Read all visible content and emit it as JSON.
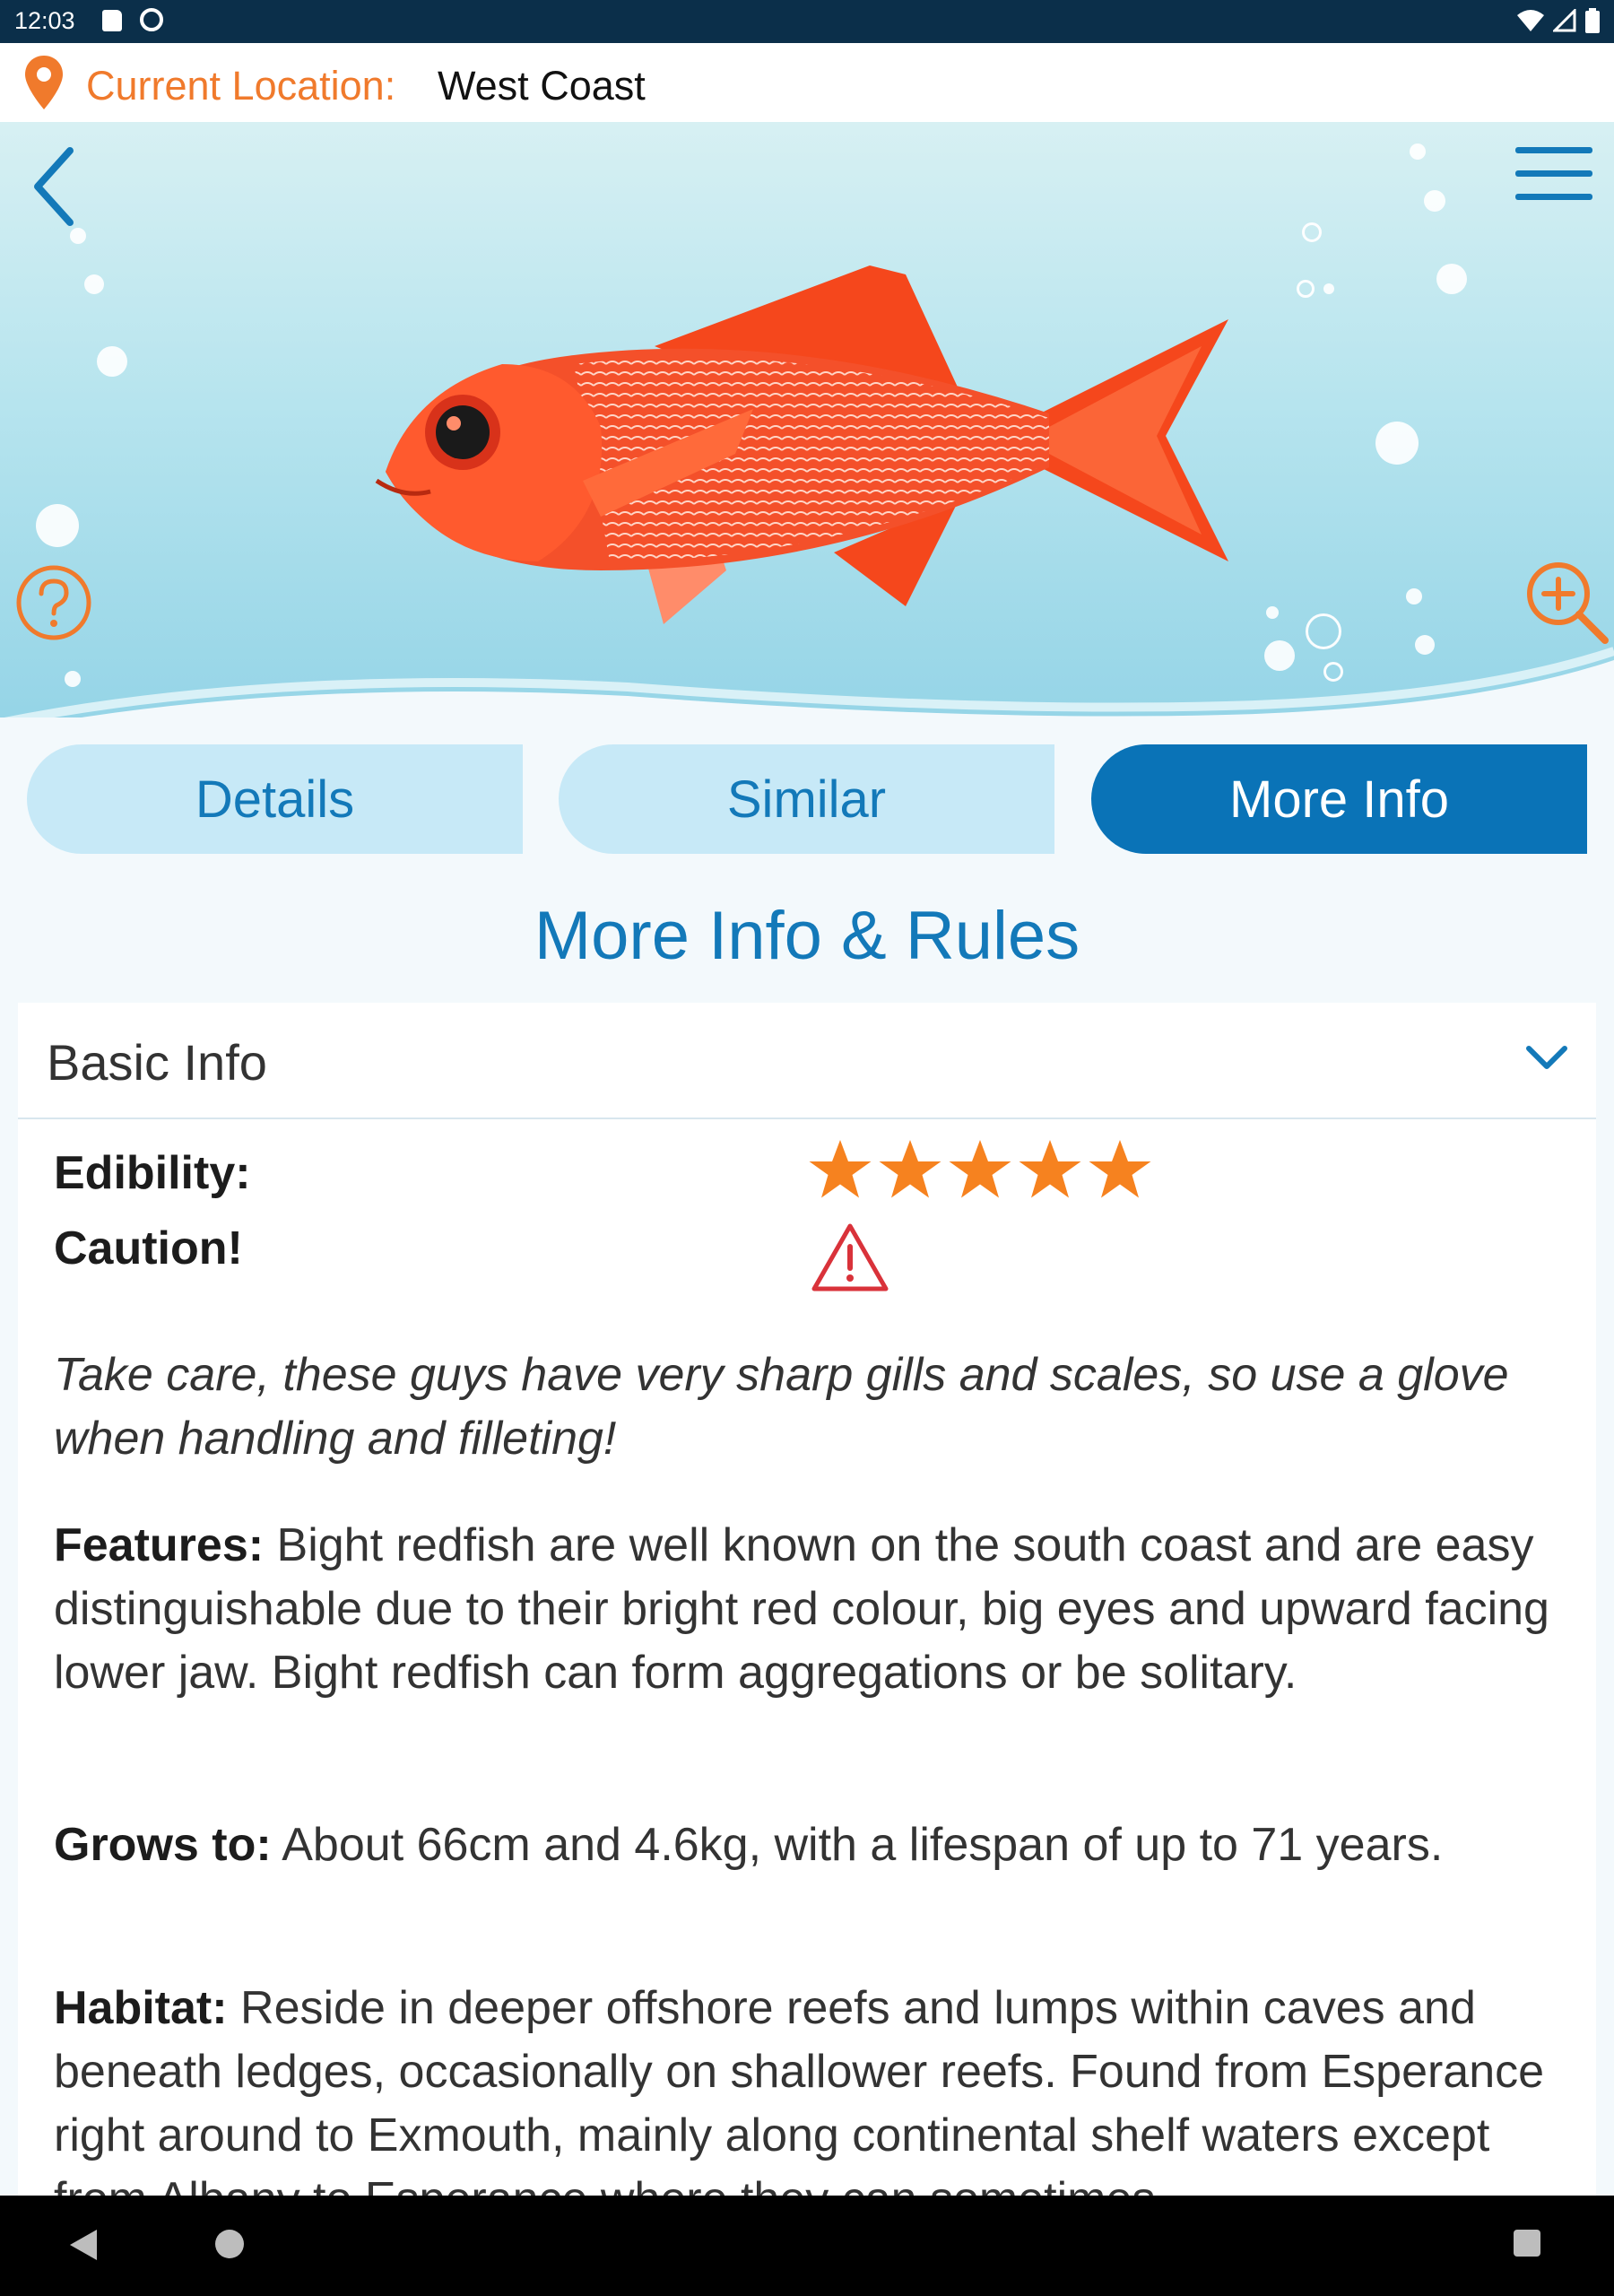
{
  "status_bar": {
    "time": "12:03",
    "icons": [
      "sd-card-icon",
      "sync-icon",
      "wifi-icon",
      "signal-icon",
      "battery-icon"
    ]
  },
  "location": {
    "label": "Current Location:",
    "value": "West Coast",
    "icon": "location-pin-icon"
  },
  "hero": {
    "image": "bight-redfish-illustration",
    "icons": [
      "back-arrow-icon",
      "hamburger-menu-icon",
      "help-icon",
      "zoom-in-icon"
    ]
  },
  "tabs": [
    {
      "label": "Details",
      "active": false
    },
    {
      "label": "Similar",
      "active": false
    },
    {
      "label": "More Info",
      "active": true
    }
  ],
  "section_title": "More Info & Rules",
  "basic_info": {
    "header": "Basic Info",
    "edibility_label": "Edibility:",
    "edibility_stars": 5,
    "caution_label": "Caution!",
    "caution_text": "Take care, these guys have very sharp gills and scales, so use a glove when handling and filleting!",
    "features_label": "Features:",
    "features_text": " Bight redfish are well known on the south coast and are easy distinguishable due to their bright red colour, big eyes and upward facing lower jaw. Bight redfish can form aggregations or be solitary.",
    "grows_label": "Grows to:",
    "grows_text": " About 66cm and 4.6kg, with a lifespan of up to 71 years.",
    "habitat_label": "Habitat:",
    "habitat_text": " Reside in deeper offshore reefs and lumps within caves and beneath ledges, occasionally on shallower reefs. Found from Esperance right around to Exmouth, mainly along continental shelf waters except from Albany to Esperance where they can sometimes"
  },
  "colors": {
    "accent_orange": "#f07a2c",
    "primary_blue": "#0a73b7",
    "tab_inactive": "#c7e9f7",
    "status_bar": "#0b2f4a"
  }
}
